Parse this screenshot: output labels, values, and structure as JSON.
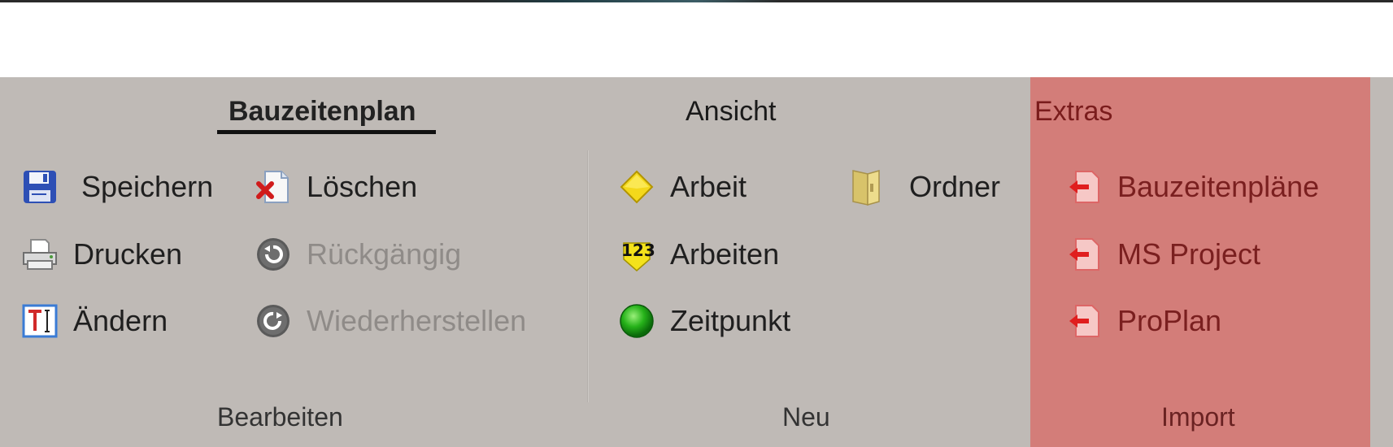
{
  "tabs": [
    {
      "label": "Bauzeitenplan",
      "active": true
    },
    {
      "label": "Ansicht",
      "active": false
    },
    {
      "label": "Extras",
      "active": false
    }
  ],
  "groups": {
    "bearbeiten": {
      "label": "Bearbeiten",
      "items": {
        "speichern": "Speichern",
        "loeschen": "Löschen",
        "drucken": "Drucken",
        "rueckgaengig": "Rückgängig",
        "aendern": "Ändern",
        "wiederherstellen": "Wiederherstellen"
      }
    },
    "neu": {
      "label": "Neu",
      "items": {
        "arbeit": "Arbeit",
        "ordner": "Ordner",
        "arbeiten": "Arbeiten",
        "zeitpunkt": "Zeitpunkt"
      }
    },
    "import": {
      "label": "Import",
      "items": {
        "bauzeitenplaene": "Bauzeitenpläne",
        "ms_project": "MS Project",
        "proplan": "ProPlan"
      }
    }
  },
  "icons": {
    "speichern": "save-icon",
    "loeschen": "delete-document-icon",
    "drucken": "printer-icon",
    "rueckgaengig": "undo-icon",
    "aendern": "edit-text-icon",
    "wiederherstellen": "redo-icon",
    "arbeit": "diamond-icon",
    "ordner": "folder-icon",
    "arbeiten": "numbered-tag-icon",
    "arbeiten_digits": "123",
    "zeitpunkt": "green-circle-icon",
    "import": "import-arrow-icon"
  },
  "colors": {
    "ribbon_bg": "#bfbab6",
    "extras_bg": "#d37d79",
    "disabled_text": "#8f8b88",
    "import_text": "#7a1f1f"
  }
}
